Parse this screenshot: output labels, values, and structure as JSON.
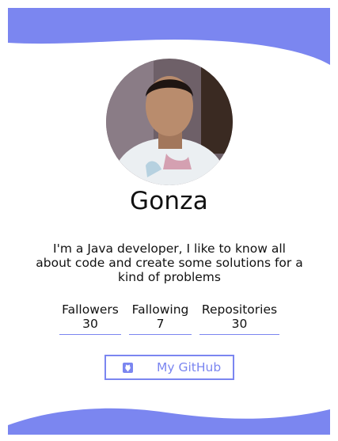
{
  "profile": {
    "name": "Gonza",
    "bio": "I'm a Java developer, I like to know all about code and create some solutions for a kind of problems"
  },
  "stats": {
    "followers": {
      "label": "Fallowers",
      "value": "30"
    },
    "following": {
      "label": "Fallowing",
      "value": "7"
    },
    "repositories": {
      "label": "Repositories",
      "value": "30"
    }
  },
  "actions": {
    "github_button": {
      "label": "My GitHub",
      "icon": "github-icon"
    }
  },
  "colors": {
    "accent": "#7b86f0",
    "text": "#111111",
    "background": "#ffffff"
  }
}
